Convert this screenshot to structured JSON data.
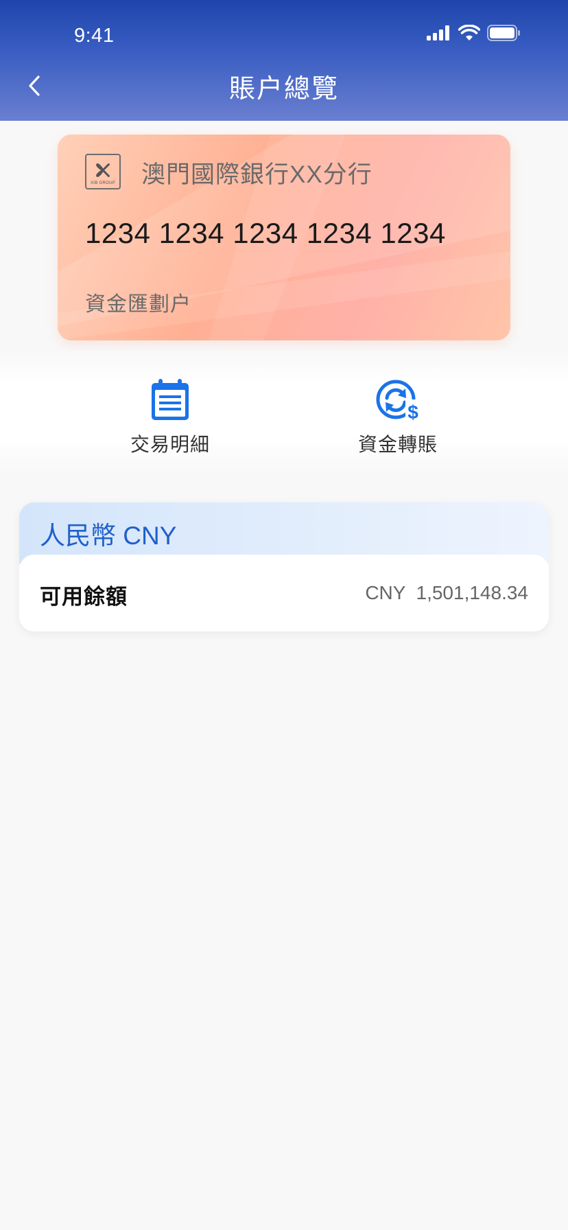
{
  "status_bar": {
    "time": "9:41"
  },
  "header": {
    "title": "賬户總覽"
  },
  "card": {
    "logo_text": "XIB GROUP",
    "bank_name": "澳門國際銀行XX分行",
    "card_number": "1234 1234 1234 1234 1234",
    "account_type": "資金匯劃户"
  },
  "actions": [
    {
      "label": "交易明細",
      "icon": "calendar-list-icon"
    },
    {
      "label": "資金轉賬",
      "icon": "refresh-dollar-icon"
    }
  ],
  "currency_section": {
    "title": "人民幣 CNY",
    "balance_label": "可用餘額",
    "balance_currency": "CNY",
    "balance_amount": "1,501,148.34"
  },
  "colors": {
    "header_top": "#1f45ad",
    "header_bottom": "#6a7fd0",
    "accent": "#1a73e8",
    "currency_title": "#2060c9"
  }
}
